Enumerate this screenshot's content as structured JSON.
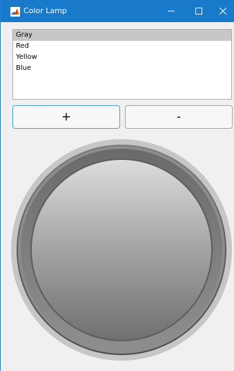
{
  "window": {
    "title": "Color Lamp",
    "icon": "matlab-icon",
    "controls": [
      "minimize-icon",
      "maximize-icon",
      "close-icon"
    ]
  },
  "listbox": {
    "items": [
      "Gray",
      "Red",
      "Yellow",
      "Blue"
    ],
    "selected": "Gray"
  },
  "buttons": {
    "plus_label": "+",
    "minus_label": "-"
  },
  "lamp": {
    "color": "Gray",
    "colors": {
      "titlebar": "#1979ca",
      "lamp_light": "#d9d9d9",
      "lamp_dark": "#6f6f6f",
      "bezel": "#c6c6c6"
    }
  }
}
